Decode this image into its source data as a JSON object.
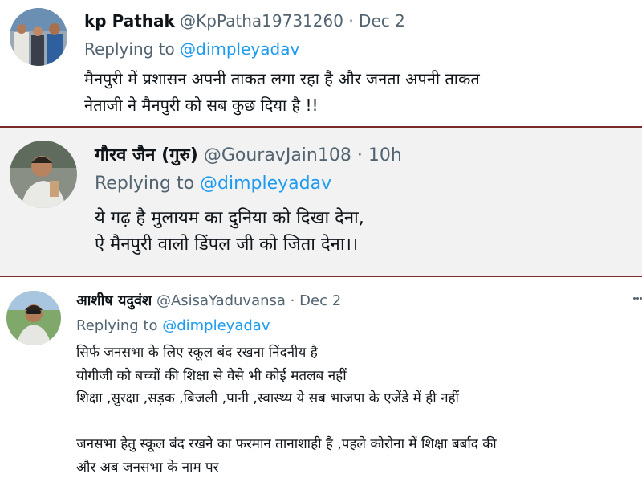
{
  "tweets": [
    {
      "name": "kp Pathak",
      "handle": "@KpPatha19731260",
      "separator": "·",
      "time": "Dec 2",
      "replying_prefix": "Replying to",
      "replying_to": "@dimpleyadav",
      "body": "मैनपुरी में प्रशासन अपनी ताकत लगा रहा है और जनता अपनी ताकत\nनेताजी ने मैनपुरी को सब कुछ दिया है !!"
    },
    {
      "name": "गौरव जैन (गुरु)",
      "handle": "@GouravJain108",
      "separator": "·",
      "time": "10h",
      "replying_prefix": "Replying to",
      "replying_to": "@dimpleyadav",
      "body": "ये गढ़ है मुलायम का दुनिया को दिखा देना,\nऐ मैनपुरी वालो डिंपल जी को जिता देना।।"
    },
    {
      "name": "आशीष यदुवंश",
      "handle": "@AsisaYaduvansa",
      "separator": "·",
      "time": "Dec 2",
      "replying_prefix": "Replying to",
      "replying_to": "@dimpleyadav",
      "body": "सिर्फ जनसभा के लिए स्कूल बंद रखना निंदनीय है\nयोगीजी को बच्चों की शिक्षा से वैसे भी कोई मतलब नहीं\nशिक्षा ,सुरक्षा ,सड़क ,बिजली ,पानी ,स्वास्थ्य ये सब भाजपा के एजेंडे में ही नहीं\n\nजनसभा हेतु स्कूल बंद रखने का फरमान तानाशाही है ,पहले कोरोना में शिक्षा बर्बाद की\nऔर अब जनसभा के नाम पर"
    }
  ],
  "icons": {
    "more": "more-options-icon",
    "avatar": "avatar"
  },
  "colors": {
    "text": "#0f1419",
    "muted": "#536471",
    "mention": "#1d9bf0",
    "divider": "#7a2a2a",
    "highlight_bg": "#f2f2f2"
  }
}
